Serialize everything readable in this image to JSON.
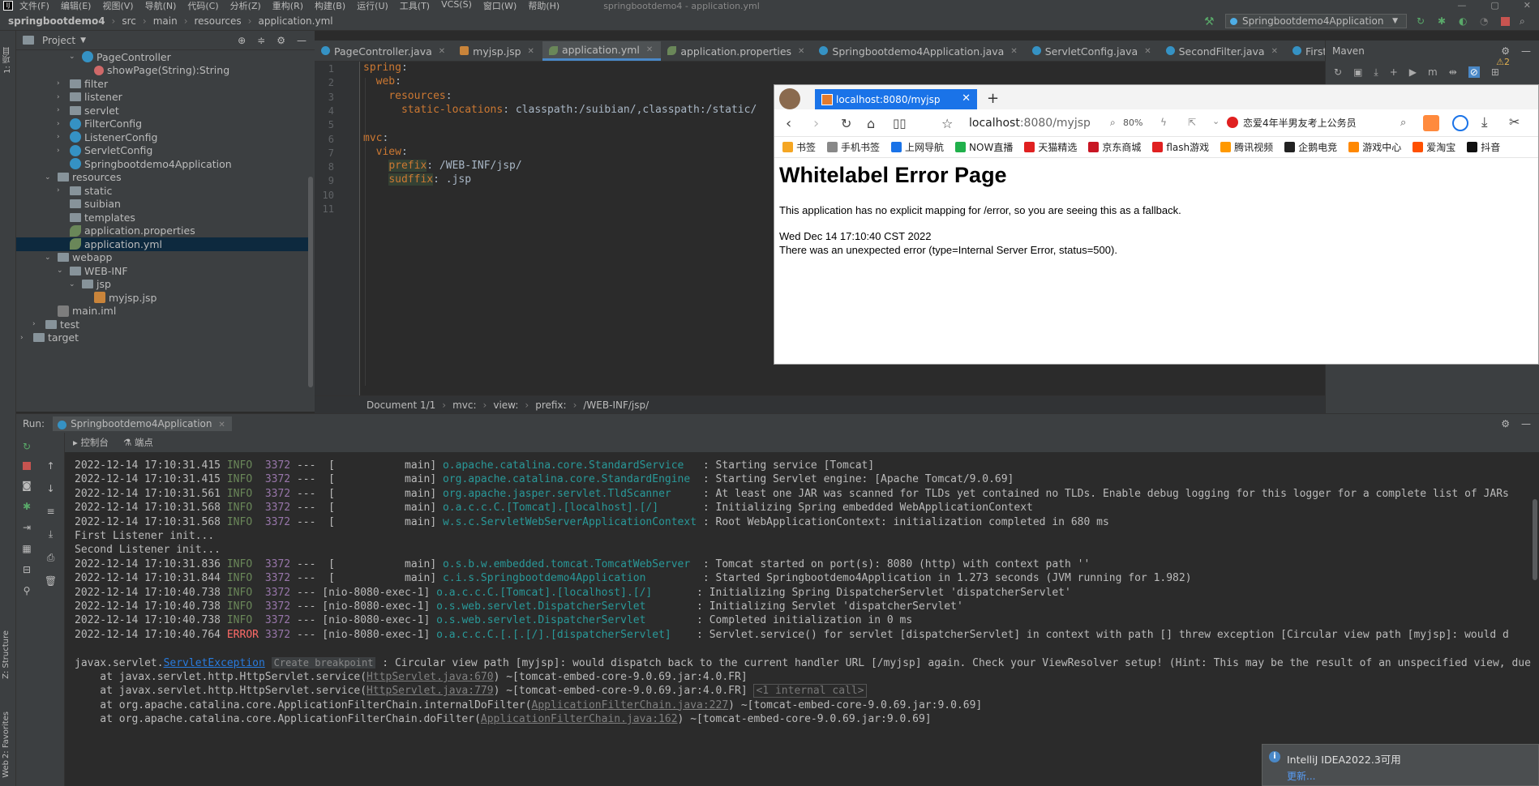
{
  "window_title": "springbootdemo4 - application.yml",
  "menu": [
    "文件(F)",
    "编辑(E)",
    "视图(V)",
    "导航(N)",
    "代码(C)",
    "分析(Z)",
    "重构(R)",
    "构建(B)",
    "运行(U)",
    "工具(T)",
    "VCS(S)",
    "窗口(W)",
    "帮助(H)"
  ],
  "breadcrumb": [
    "springbootdemo4",
    "src",
    "main",
    "resources",
    "application.yml"
  ],
  "run_config": "Springbootdemo4Application",
  "side_tabs": {
    "project": "1: 项目",
    "structure": "Z: Structure",
    "favorites": "2: Favorites",
    "web": "Web"
  },
  "project_panel": {
    "title": "Project",
    "tree": [
      {
        "label": "PageController",
        "icon": "cls",
        "arrow": "down",
        "indent": 5
      },
      {
        "label": "showPage(String):String",
        "icon": "method",
        "arrow": "",
        "indent": 6
      },
      {
        "label": "filter",
        "icon": "folder",
        "arrow": "right",
        "indent": 4
      },
      {
        "label": "listener",
        "icon": "folder",
        "arrow": "right",
        "indent": 4
      },
      {
        "label": "servlet",
        "icon": "folder",
        "arrow": "right",
        "indent": 4
      },
      {
        "label": "FilterConfig",
        "icon": "cls",
        "arrow": "right",
        "indent": 4
      },
      {
        "label": "ListenerConfig",
        "icon": "cls",
        "arrow": "right",
        "indent": 4
      },
      {
        "label": "ServletConfig",
        "icon": "cls",
        "arrow": "right",
        "indent": 4
      },
      {
        "label": "Springbootdemo4Application",
        "icon": "cls",
        "arrow": "",
        "indent": 4
      },
      {
        "label": "resources",
        "icon": "folder",
        "arrow": "down",
        "indent": 3
      },
      {
        "label": "static",
        "icon": "folder",
        "arrow": "right",
        "indent": 4
      },
      {
        "label": "suibian",
        "icon": "folder",
        "arrow": "",
        "indent": 4
      },
      {
        "label": "templates",
        "icon": "folder",
        "arrow": "",
        "indent": 4
      },
      {
        "label": "application.properties",
        "icon": "leaf",
        "arrow": "",
        "indent": 4
      },
      {
        "label": "application.yml",
        "icon": "leaf",
        "arrow": "",
        "indent": 4,
        "selected": true
      },
      {
        "label": "webapp",
        "icon": "folder",
        "arrow": "down",
        "indent": 3
      },
      {
        "label": "WEB-INF",
        "icon": "folder",
        "arrow": "down",
        "indent": 4
      },
      {
        "label": "jsp",
        "icon": "folder",
        "arrow": "down",
        "indent": 5
      },
      {
        "label": "myjsp.jsp",
        "icon": "jsp",
        "arrow": "",
        "indent": 6
      },
      {
        "label": "main.iml",
        "icon": "iml",
        "arrow": "",
        "indent": 3
      },
      {
        "label": "test",
        "icon": "folder",
        "arrow": "right",
        "indent": 2
      },
      {
        "label": "target",
        "icon": "folder",
        "arrow": "right",
        "indent": 1
      }
    ]
  },
  "editor_tabs": [
    {
      "label": "PageController.java",
      "type": "java"
    },
    {
      "label": "myjsp.jsp",
      "type": "jsp"
    },
    {
      "label": "application.yml",
      "type": "xml",
      "active": true
    },
    {
      "label": "application.properties",
      "type": "xml"
    },
    {
      "label": "Springbootdemo4Application.java",
      "type": "java"
    },
    {
      "label": "ServletConfig.java",
      "type": "java"
    },
    {
      "label": "SecondFilter.java",
      "type": "java"
    },
    {
      "label": "FirstFilter.ja",
      "type": "java"
    }
  ],
  "maven_title": "Maven",
  "warnings_count": "⚠2",
  "code_lines": [
    {
      "n": "1",
      "key": "spring",
      "val": ""
    },
    {
      "n": "2",
      "key": "  web",
      "val": ""
    },
    {
      "n": "3",
      "key": "    resources",
      "val": ""
    },
    {
      "n": "4",
      "key": "      static-locations",
      "val": " classpath:/suibian/,classpath:/static/"
    },
    {
      "n": "5",
      "key": "",
      "val": ""
    },
    {
      "n": "6",
      "key": "mvc",
      "val": ""
    },
    {
      "n": "7",
      "key": "  view",
      "val": ""
    },
    {
      "n": "8",
      "key": "    prefix",
      "val": " /WEB-INF/jsp/",
      "hl": true
    },
    {
      "n": "9",
      "key": "    sudffix",
      "val": " .jsp",
      "hl": true
    },
    {
      "n": "10",
      "key": "",
      "val": ""
    },
    {
      "n": "11",
      "key": "",
      "val": ""
    }
  ],
  "editor_breadcrumb": [
    "Document 1/1",
    "mvc:",
    "view:",
    "prefix:",
    "/WEB-INF/jsp/"
  ],
  "browser": {
    "tab_title": "localhost:8080/myjsp",
    "url_host": "localhost",
    "url_path": ":8080/myjsp",
    "zoom": "80%",
    "search_text": "恋爱4年半男友考上公务员",
    "bookmarks": [
      {
        "label": "书签",
        "color": "#f5a623"
      },
      {
        "label": "手机书签",
        "color": "#888888"
      },
      {
        "label": "上网导航",
        "color": "#1a73e8"
      },
      {
        "label": "NOW直播",
        "color": "#20b04b"
      },
      {
        "label": "天猫精选",
        "color": "#e02020"
      },
      {
        "label": "京东商城",
        "color": "#c81623"
      },
      {
        "label": "flash游戏",
        "color": "#e02020"
      },
      {
        "label": "腾讯视频",
        "color": "#ff9900"
      },
      {
        "label": "企鹅电竞",
        "color": "#222222"
      },
      {
        "label": "游戏中心",
        "color": "#ff8800"
      },
      {
        "label": "爱淘宝",
        "color": "#ff5000"
      },
      {
        "label": "抖音",
        "color": "#111111"
      }
    ],
    "heading": "Whitelabel Error Page",
    "message": "This application has no explicit mapping for /error, so you are seeing this as a fallback.",
    "date": "Wed Dec 14 17:10:40 CST 2022",
    "error": "There was an unexpected error (type=Internal Server Error, status=500)."
  },
  "run_panel": {
    "label": "Run:",
    "tab": "Springbootdemo4Application",
    "console_tab": "控制台",
    "endpoints_tab": "端点"
  },
  "console_lines": [
    {
      "ts": "2022-12-14 17:10:31.415",
      "lvl": "INFO",
      "pid": "3372",
      "thread": "---  [           main]",
      "logger": "o.apache.catalina.core.StandardService  ",
      "msg": " : Starting service [Tomcat]"
    },
    {
      "ts": "2022-12-14 17:10:31.415",
      "lvl": "INFO",
      "pid": "3372",
      "thread": "---  [           main]",
      "logger": "org.apache.catalina.core.StandardEngine ",
      "msg": " : Starting Servlet engine: [Apache Tomcat/9.0.69]"
    },
    {
      "ts": "2022-12-14 17:10:31.561",
      "lvl": "INFO",
      "pid": "3372",
      "thread": "---  [           main]",
      "logger": "org.apache.jasper.servlet.TldScanner    ",
      "msg": " : At least one JAR was scanned for TLDs yet contained no TLDs. Enable debug logging for this logger for a complete list of JARs"
    },
    {
      "ts": "2022-12-14 17:10:31.568",
      "lvl": "INFO",
      "pid": "3372",
      "thread": "---  [           main]",
      "logger": "o.a.c.c.C.[Tomcat].[localhost].[/]      ",
      "msg": " : Initializing Spring embedded WebApplicationContext"
    },
    {
      "ts": "2022-12-14 17:10:31.568",
      "lvl": "INFO",
      "pid": "3372",
      "thread": "---  [           main]",
      "logger": "w.s.c.ServletWebServerApplicationContext",
      "msg": " : Root WebApplicationContext: initialization completed in 680 ms"
    },
    {
      "plain": "First Listener init..."
    },
    {
      "plain": "Second Listener init..."
    },
    {
      "ts": "2022-12-14 17:10:31.836",
      "lvl": "INFO",
      "pid": "3372",
      "thread": "---  [           main]",
      "logger": "o.s.b.w.embedded.tomcat.TomcatWebServer ",
      "msg": " : Tomcat started on port(s): 8080 (http) with context path ''"
    },
    {
      "ts": "2022-12-14 17:10:31.844",
      "lvl": "INFO",
      "pid": "3372",
      "thread": "---  [           main]",
      "logger": "c.i.s.Springbootdemo4Application        ",
      "msg": " : Started Springbootdemo4Application in 1.273 seconds (JVM running for 1.982)"
    },
    {
      "ts": "2022-12-14 17:10:40.738",
      "lvl": "INFO",
      "pid": "3372",
      "thread": "--- [nio-8080-exec-1]",
      "logger": "o.a.c.c.C.[Tomcat].[localhost].[/]      ",
      "msg": " : Initializing Spring DispatcherServlet 'dispatcherServlet'"
    },
    {
      "ts": "2022-12-14 17:10:40.738",
      "lvl": "INFO",
      "pid": "3372",
      "thread": "--- [nio-8080-exec-1]",
      "logger": "o.s.web.servlet.DispatcherServlet       ",
      "msg": " : Initializing Servlet 'dispatcherServlet'"
    },
    {
      "ts": "2022-12-14 17:10:40.738",
      "lvl": "INFO",
      "pid": "3372",
      "thread": "--- [nio-8080-exec-1]",
      "logger": "o.s.web.servlet.DispatcherServlet       ",
      "msg": " : Completed initialization in 0 ms"
    },
    {
      "ts": "2022-12-14 17:10:40.764",
      "lvl": "ERROR",
      "pid": "3372",
      "thread": "--- [nio-8080-exec-1]",
      "logger": "o.a.c.c.C.[.[.[/].[dispatcherServlet]   ",
      "msg": " : Servlet.service() for servlet [dispatcherServlet] in context with path [] threw exception [Circular view path [myjsp]: would d"
    }
  ],
  "exception": {
    "prefix": "javax.servlet.",
    "cls": "ServletException",
    "bp": "Create breakpoint",
    "msg": " : Circular view path [myjsp]: would dispatch back to the current handler URL [/myjsp] again. Check your ViewResolver setup! (Hint: This may be the result of an unspecified view, due"
  },
  "stack": [
    {
      "pre": "    at javax.servlet.http.HttpServlet.service(",
      "link": "HttpServlet.java:670",
      "post": ") ~[tomcat-embed-core-9.0.69.jar:4.0.FR]",
      "extra": ""
    },
    {
      "pre": "    at javax.servlet.http.HttpServlet.service(",
      "link": "HttpServlet.java:779",
      "post": ") ~[tomcat-embed-core-9.0.69.jar:4.0.FR] ",
      "extra": "<1 internal call>"
    },
    {
      "pre": "    at org.apache.catalina.core.ApplicationFilterChain.internalDoFilter(",
      "link": "ApplicationFilterChain.java:227",
      "post": ") ~[tomcat-embed-core-9.0.69.jar:9.0.69]",
      "extra": ""
    },
    {
      "pre": "    at org.apache.catalina.core.ApplicationFilterChain.doFilter(",
      "link": "ApplicationFilterChain.java:162",
      "post": ") ~[tomcat-embed-core-9.0.69.jar:9.0.69]",
      "extra": ""
    }
  ],
  "notification": {
    "title": "IntelliJ IDEA2022.3可用",
    "link": "更新..."
  }
}
